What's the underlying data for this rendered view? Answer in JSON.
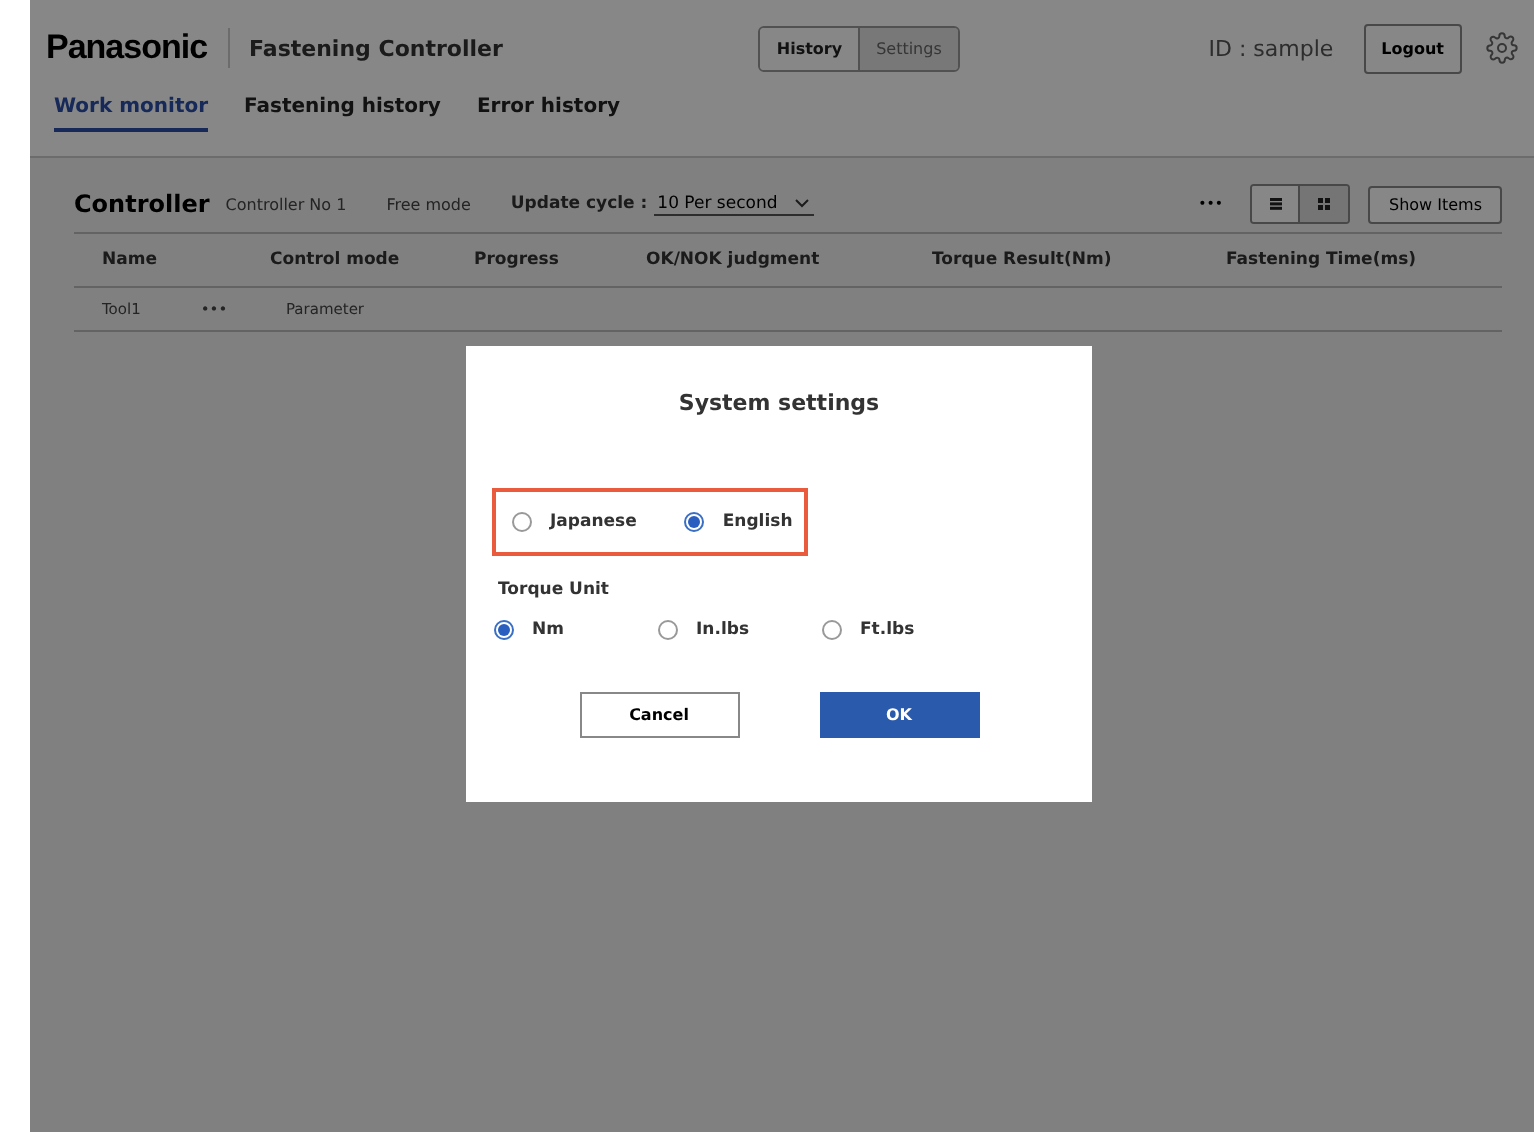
{
  "header": {
    "brand": "Panasonic",
    "title": "Fastening Controller",
    "segments": [
      {
        "label": "History",
        "selected": false
      },
      {
        "label": "Settings",
        "selected": true
      }
    ],
    "user": "ID : sample",
    "logout": "Logout"
  },
  "tabs": [
    {
      "label": "Work monitor",
      "selected": true
    },
    {
      "label": "Fastening history",
      "selected": false
    },
    {
      "label": "Error history",
      "selected": false
    }
  ],
  "controller": {
    "title": "Controller",
    "name": "Controller No 1",
    "mode": "Free mode",
    "cycle_label": "Update cycle :",
    "cycle_value": "10 Per second",
    "more": "•••",
    "views": [
      {
        "kind": "list",
        "selected": false
      },
      {
        "kind": "grid",
        "selected": true
      }
    ],
    "show_items": "Show Items"
  },
  "table": {
    "columns": [
      "Name",
      "Control mode",
      "Progress",
      "OK/NOK judgment",
      "Torque Result(Nm)",
      "Fastening Time(ms)"
    ],
    "rows": [
      {
        "name": "Tool1",
        "menu": "•••",
        "mode": "Parameter"
      }
    ]
  },
  "dialog": {
    "title": "System settings",
    "language_options": [
      {
        "label": "Japanese",
        "selected": false
      },
      {
        "label": "English",
        "selected": true
      }
    ],
    "highlighted": true,
    "torque_label": "Torque Unit",
    "torque_options": [
      {
        "label": "Nm",
        "selected": true
      },
      {
        "label": "In.lbs",
        "selected": false
      },
      {
        "label": "Ft.lbs",
        "selected": false
      }
    ],
    "cancel": "Cancel",
    "ok": "OK"
  }
}
